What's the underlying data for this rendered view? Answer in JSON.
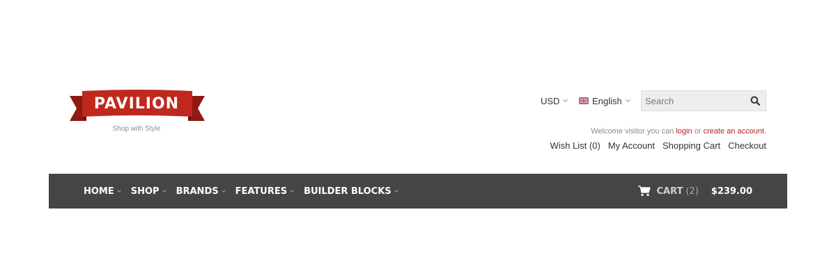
{
  "logo": {
    "name": "PAVILION",
    "tagline": "Shop with Style",
    "color": "#c0281e"
  },
  "topbar": {
    "currency": "USD",
    "language": "English",
    "search_placeholder": "Search",
    "search_value": ""
  },
  "welcome": {
    "prefix": "Welcome visitor you can",
    "login": "login",
    "or": "or",
    "create": "create an account",
    "suffix": "."
  },
  "account_links": [
    "Wish List (0)",
    "My Account",
    "Shopping Cart",
    "Checkout"
  ],
  "nav": {
    "items": [
      "HOME",
      "SHOP",
      "BRANDS",
      "FEATURES",
      "BUILDER BLOCKS"
    ],
    "background": "#454545"
  },
  "cart": {
    "label": "CART",
    "count": "(2)",
    "total": "$239.00"
  },
  "icons": {
    "search": "search-icon",
    "cart": "cart-icon",
    "flag": "uk-flag-icon"
  }
}
